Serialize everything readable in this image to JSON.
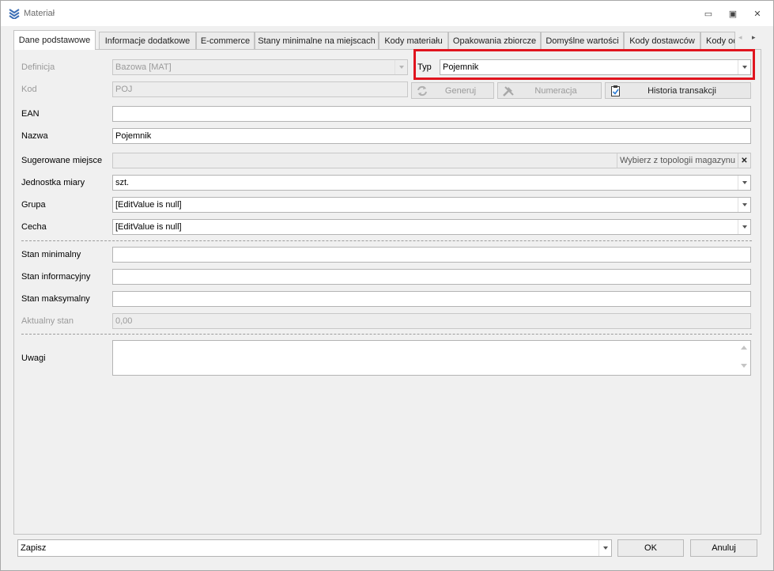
{
  "window": {
    "title": "Materiał",
    "minimize_glyph": "▭",
    "maximize_glyph": "▣",
    "close_glyph": "✕"
  },
  "tabs": [
    {
      "label": "Dane podstawowe",
      "active": true
    },
    {
      "label": "Informacje dodatkowe"
    },
    {
      "label": "E-commerce"
    },
    {
      "label": "Stany minimalne na miejscach"
    },
    {
      "label": "Kody materiału"
    },
    {
      "label": "Opakowania zbiorcze"
    },
    {
      "label": "Domyślne wartości"
    },
    {
      "label": "Kody dostawców"
    },
    {
      "label": "Kody od"
    }
  ],
  "tab_scroll": {
    "left": "◂",
    "right": "▸"
  },
  "form": {
    "definicja": {
      "label": "Definicja",
      "value": "Bazowa [MAT]"
    },
    "typ": {
      "label": "Typ",
      "value": "Pojemnik"
    },
    "kod": {
      "label": "Kod",
      "value": "POJ"
    },
    "generuj": "Generuj",
    "numeracja": "Numeracja",
    "historia": "Historia transakcji",
    "ean": {
      "label": "EAN",
      "value": ""
    },
    "nazwa": {
      "label": "Nazwa",
      "value": "Pojemnik"
    },
    "sugerowane": {
      "label": "Sugerowane miejsce",
      "value": "",
      "pick_text": "Wybierz z topologii magazynu",
      "clear_glyph": "✕"
    },
    "jednostka": {
      "label": "Jednostka miary",
      "value": "szt."
    },
    "grupa": {
      "label": "Grupa",
      "value": "[EditValue is null]"
    },
    "cecha": {
      "label": "Cecha",
      "value": "[EditValue is null]"
    },
    "stan_min": {
      "label": "Stan minimalny",
      "value": ""
    },
    "stan_info": {
      "label": "Stan informacyjny",
      "value": ""
    },
    "stan_max": {
      "label": "Stan maksymalny",
      "value": ""
    },
    "aktualny": {
      "label": "Aktualny stan",
      "value": "0,00"
    },
    "uwagi": {
      "label": "Uwagi",
      "value": ""
    }
  },
  "footer": {
    "action": "Zapisz",
    "ok": "OK",
    "cancel": "Anuluj"
  },
  "colors": {
    "highlight": "#e0141e",
    "app_icon": "#3d6fb5"
  }
}
